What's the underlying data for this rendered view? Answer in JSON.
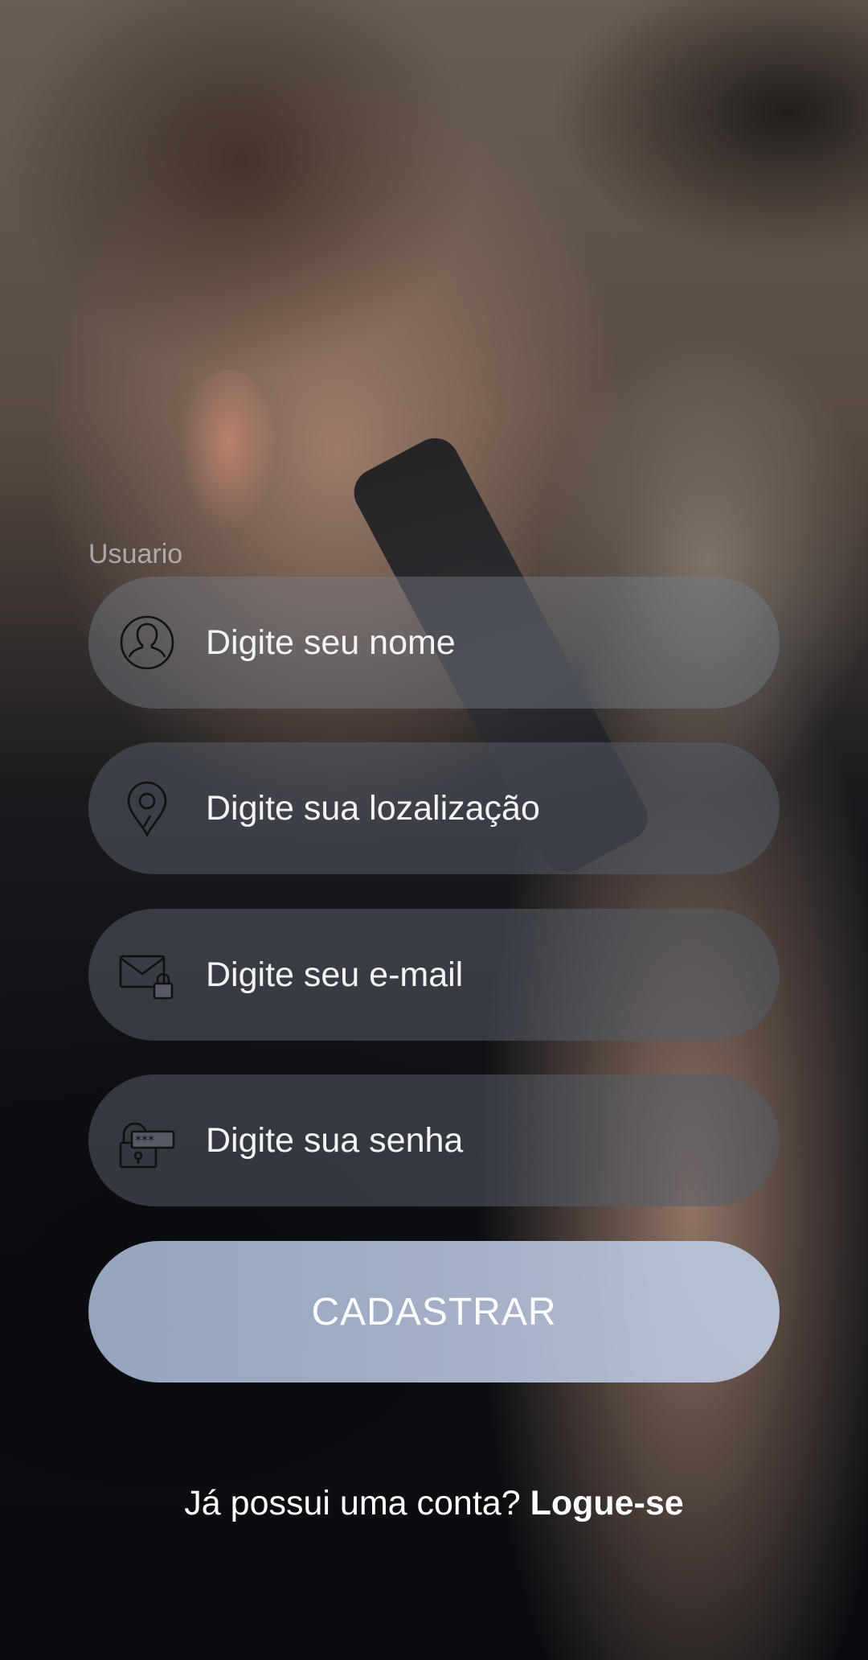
{
  "form": {
    "label": "Usuario",
    "fields": [
      {
        "icon": "user-icon",
        "placeholder": "Digite seu nome",
        "type": "text"
      },
      {
        "icon": "location-pin-icon",
        "placeholder": "Digite sua lozalização",
        "type": "text"
      },
      {
        "icon": "email-lock-icon",
        "placeholder": "Digite seu e-mail",
        "type": "email"
      },
      {
        "icon": "password-lock-icon",
        "placeholder": "Digite sua senha",
        "type": "password"
      }
    ],
    "submit_label": "CADASTRAR"
  },
  "footer": {
    "prompt": "Já possui uma conta?",
    "link_label": "Logue-se"
  },
  "colors": {
    "button_gradient_start": "#a0b2cc",
    "button_gradient_end": "#bec8de",
    "text": "#ffffff"
  }
}
